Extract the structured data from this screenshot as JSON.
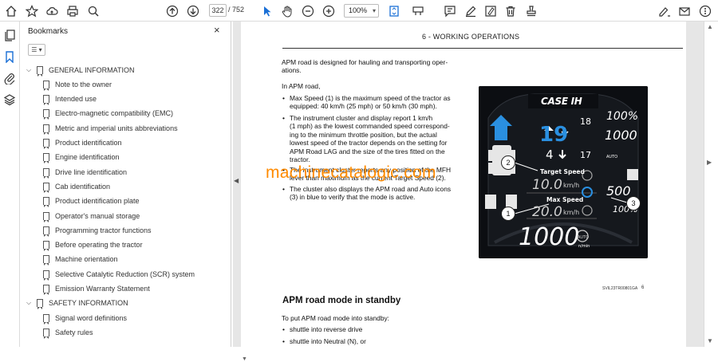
{
  "toolbar": {
    "page_current": "322",
    "page_total": "/ 752",
    "zoom": "100%"
  },
  "bookmarks": {
    "title": "Bookmarks",
    "close": "×",
    "options": "☰ ▾",
    "items": [
      {
        "label": "GENERAL INFORMATION",
        "level": 0
      },
      {
        "label": "Note to the owner",
        "level": 1
      },
      {
        "label": "Intended use",
        "level": 1
      },
      {
        "label": "Electro-magnetic compatibility (EMC)",
        "level": 1
      },
      {
        "label": "Metric and imperial units abbreviations",
        "level": 1
      },
      {
        "label": "Product identification",
        "level": 1
      },
      {
        "label": "Engine identification",
        "level": 1
      },
      {
        "label": "Drive line identification",
        "level": 1
      },
      {
        "label": "Cab identification",
        "level": 1
      },
      {
        "label": "Product identification plate",
        "level": 1
      },
      {
        "label": "Operator's manual storage",
        "level": 1
      },
      {
        "label": "Programming tractor functions",
        "level": 1
      },
      {
        "label": "Before operating the tractor",
        "level": 1
      },
      {
        "label": "Machine orientation",
        "level": 1
      },
      {
        "label": "Selective Catalytic Reduction (SCR) system",
        "level": 1
      },
      {
        "label": "Emission Warranty Statement",
        "level": 1
      },
      {
        "label": "SAFETY INFORMATION",
        "level": 0
      },
      {
        "label": "Signal word definitions",
        "level": 1
      },
      {
        "label": "Safety rules",
        "level": 1
      }
    ]
  },
  "document": {
    "header": "6 - WORKING OPERATIONS",
    "intro": [
      "APM road is designed for hauling and transporting oper-",
      "ations."
    ],
    "in_apm": "In APM road,",
    "bullets": [
      [
        "Max Speed (1) is the maximum speed of the tractor as",
        "equipped: 40 km/h (25 mph) or 50 km/h (30 mph)."
      ],
      [
        "The instrument cluster and display report 1 km/h",
        "(1 mph) as the lowest commanded speed correspond-",
        "ing to the minimum throttle position, but the actual",
        "lowest speed of the tractor depends on the setting for",
        "APM Road LAG and the size of the tires fitted on the",
        "tractor."
      ],
      [
        "The instrument cluster reports any position of the MFH",
        "lever than maximum as the current Target Speed (2)."
      ],
      [
        "The cluster also displays the APM road and Auto icons",
        "(3) in blue to verify that the mode is active."
      ]
    ],
    "watermark": "machinecatalogic.com",
    "fig_caption": "SVIL23TR00801GA",
    "fig_number": "6",
    "section_heading": "APM road mode in standby",
    "standby_intro": "To put APM road mode into standby:",
    "standby_bullets": [
      "shuttle into reverse drive",
      "shuttle into Neutral (N), or"
    ]
  },
  "figure": {
    "brand": "CASE IH",
    "gear_big": "19",
    "gear_small": "4",
    "right_top": "18",
    "right_bottom": "17",
    "pct_top": "100%",
    "rpm_top": "1000",
    "auto": "AUTO",
    "target_speed_label": "Target Speed",
    "target_speed_value": "10.0",
    "max_speed_label": "Max Speed",
    "max_speed_value": "20.0",
    "unit": "km/h",
    "mid_right": "500",
    "pct_bottom": "100%",
    "engine_rpm": "1000",
    "rpm_unit": "n/min",
    "callouts": [
      "1",
      "2",
      "3"
    ],
    "accent": "#2a8fe0"
  }
}
